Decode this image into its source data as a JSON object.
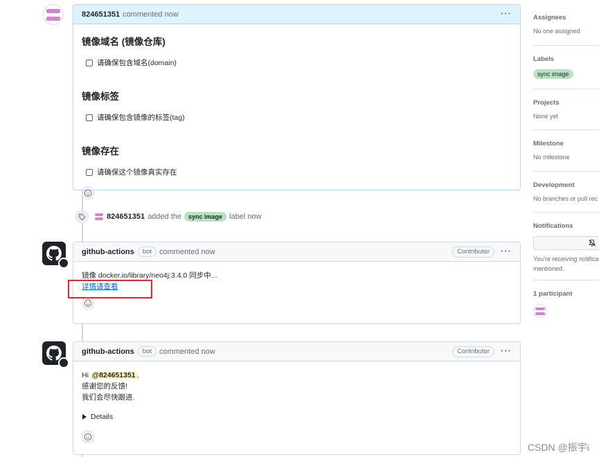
{
  "first_comment": {
    "author": "824651351",
    "meta": "commented now",
    "sections": [
      {
        "heading": "镜像域名 (镜像仓库)",
        "checkbox": "请确保包含域名(domain)"
      },
      {
        "heading": "镜像标签",
        "checkbox": "请确保包含镜像的标签(tag)"
      },
      {
        "heading": "镜像存在",
        "checkbox": "请确保这个镜像真实存在"
      }
    ]
  },
  "label_event": {
    "actor": "824651351",
    "action": "added the",
    "label": "sync image",
    "suffix": "label now"
  },
  "bot_comment_1": {
    "author": "github-actions",
    "bot_badge": "bot",
    "meta": "commented now",
    "role": "Contributor",
    "line1": "镜像 docker.io/library/neo4j:3.4.0 同步中...",
    "link": "详情请查看"
  },
  "bot_comment_2": {
    "author": "github-actions",
    "bot_badge": "bot",
    "meta": "commented now",
    "role": "Contributor",
    "greeting": "Hi",
    "mention": "@824651351",
    "mention_suffix": ",",
    "line2": "感谢您的反馈!",
    "line3": "我们会尽快跟进.",
    "details": "Details"
  },
  "kebab_label": "···",
  "sidebar": {
    "assignees_title": "Assignees",
    "assignees_value": "No one assigned",
    "labels_title": "Labels",
    "label_pill": "sync image",
    "projects_title": "Projects",
    "projects_value": "None yet",
    "milestone_title": "Milestone",
    "milestone_value": "No milestone",
    "development_title": "Development",
    "development_value": "No branches or pull rec",
    "notifications_title": "Notifications",
    "notifications_line1": "You're receiving notifica",
    "notifications_line2": "mentioned.",
    "participants_title": "1 participant"
  },
  "watermark": "CSDN @振宇i",
  "colors": {
    "accent_link": "#0969da",
    "label_green": "#b7e3c0",
    "highlight_red": "#e5262b",
    "identicon_pink": "#d084d2"
  }
}
